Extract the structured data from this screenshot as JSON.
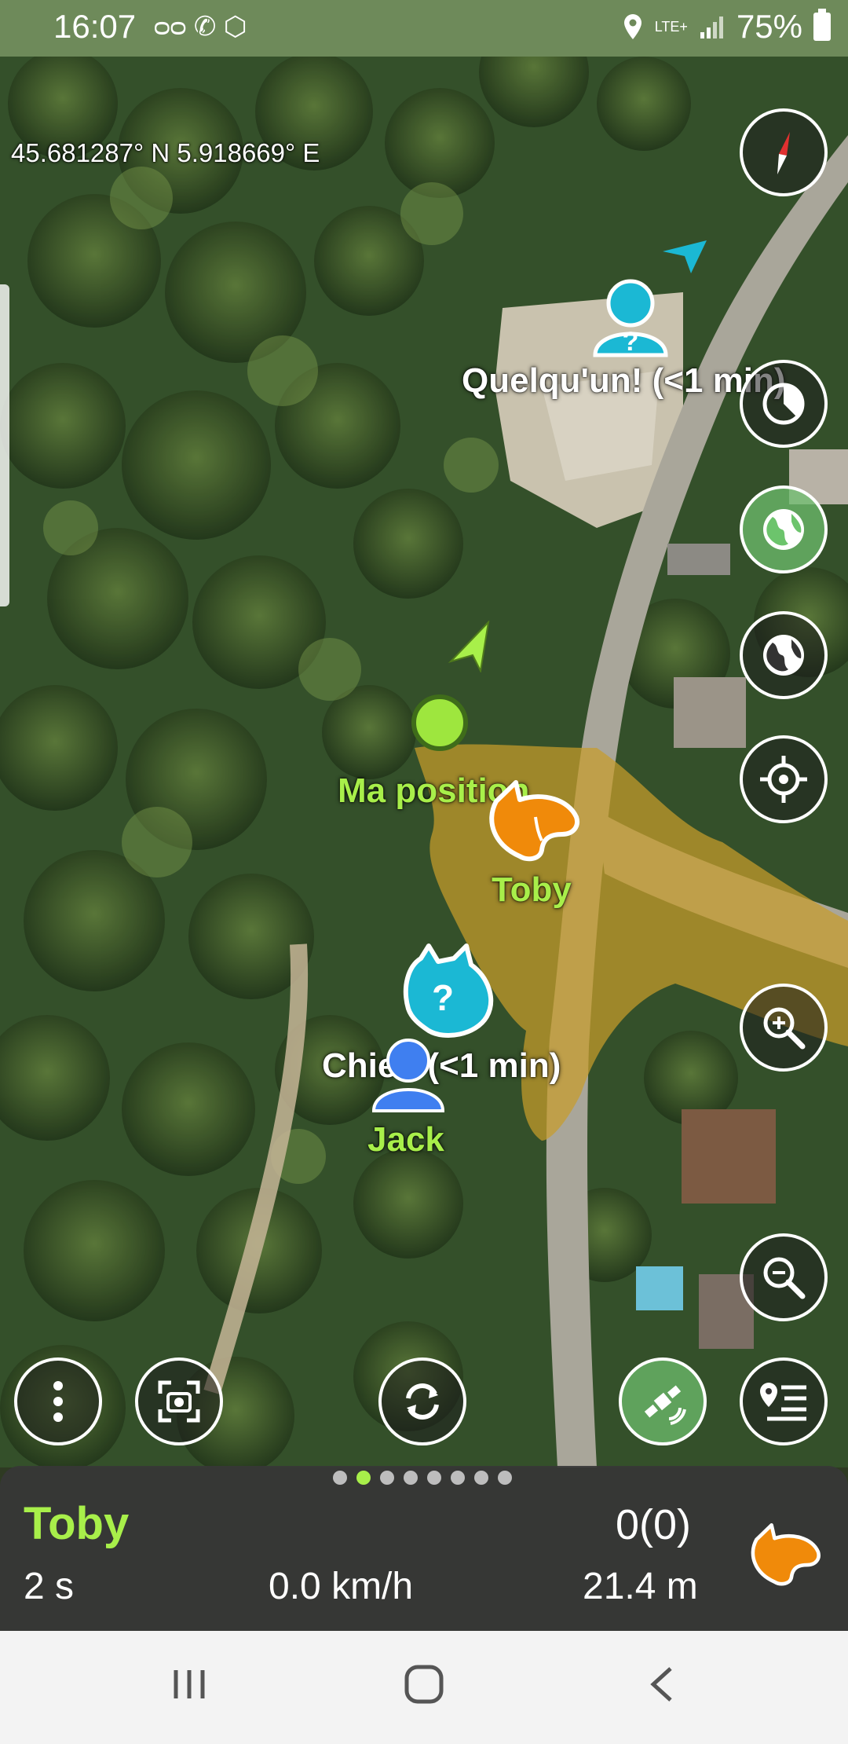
{
  "status": {
    "time": "16:07",
    "left_icons": "ᴑᴑ ✆ ⬡",
    "network": "LTE+",
    "battery": "75%"
  },
  "map": {
    "coordinates": "45.681287° N 5.918669° E",
    "labels": {
      "unknown_person": "Quelqu'un! (<1 min)",
      "my_position": "Ma position",
      "toby": "Toby",
      "dog_unknown": "Chien (<1 min)",
      "jack": "Jack"
    }
  },
  "icons": {
    "compass": "compass-icon",
    "timer": "timer-icon",
    "globe_green": "globe-icon",
    "globe": "globe-icon",
    "locate": "crosshair-icon",
    "zoom_in": "zoom-in-icon",
    "zoom_out": "zoom-out-icon",
    "menu": "more-vertical-icon",
    "screenshot": "capture-icon",
    "refresh": "refresh-icon",
    "satellite": "satellite-icon",
    "layers": "waypoint-list-icon"
  },
  "panel": {
    "dog_name": "Toby",
    "time_since": "2 s",
    "speed": "0.0 km/h",
    "count": "0(0)",
    "distance": "21.4 m",
    "page_count": 8,
    "active_page": 2
  },
  "colors": {
    "accent_green": "#a8ef4a",
    "toby_orange": "#f08a0a",
    "unknown_cyan": "#1bb8d4",
    "jack_blue": "#3f7ff0",
    "zone_fill": "#c89d2b"
  }
}
